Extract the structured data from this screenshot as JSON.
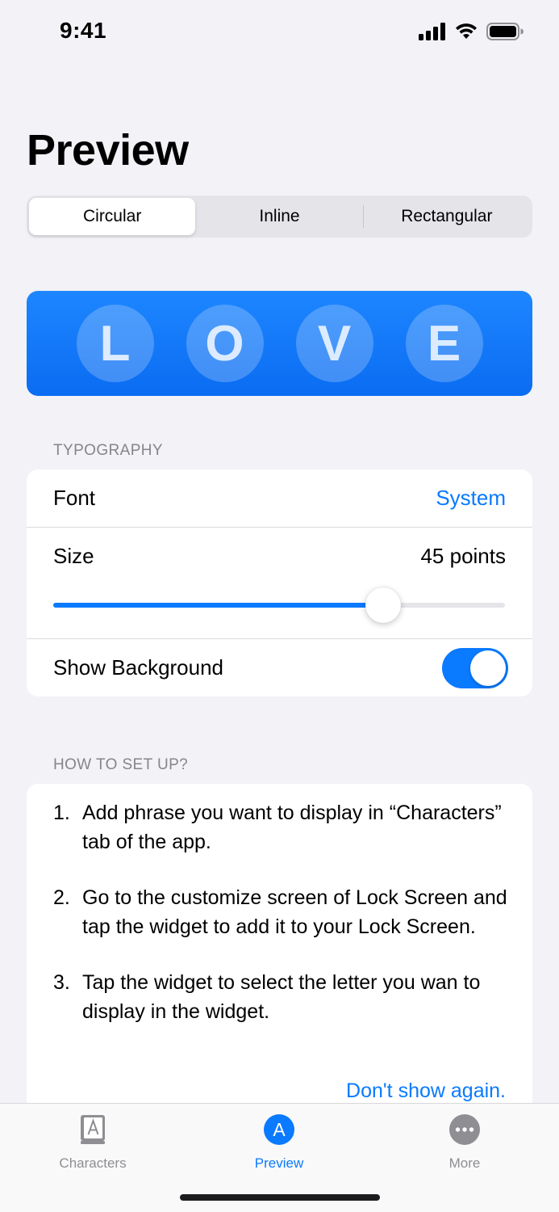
{
  "status_bar": {
    "time": "9:41"
  },
  "title": "Preview",
  "segments": [
    {
      "label": "Circular",
      "active": true
    },
    {
      "label": "Inline",
      "active": false
    },
    {
      "label": "Rectangular",
      "active": false
    }
  ],
  "preview": {
    "letters": [
      "L",
      "O",
      "V",
      "E"
    ],
    "background_color": "#0A6CF2"
  },
  "typography": {
    "header": "TYPOGRAPHY",
    "font_label": "Font",
    "font_value": "System",
    "size_label": "Size",
    "size_value": "45 points",
    "size_slider_fraction": 0.73,
    "show_background_label": "Show Background",
    "show_background_on": true
  },
  "setup": {
    "header": "HOW TO SET UP?",
    "steps": [
      {
        "num": "1.",
        "text": "Add phrase you want to display in “Characters” tab of the app."
      },
      {
        "num": "2.",
        "text": "Go to the customize screen of Lock Screen and tap the widget to add it to your Lock Screen."
      },
      {
        "num": "3.",
        "text": "Tap the widget to select the letter you wan to display in the widget."
      }
    ],
    "dont_show_label": "Don't show again."
  },
  "tab_bar": {
    "items": [
      {
        "label": "Characters",
        "icon": "book-letter-icon",
        "active": false
      },
      {
        "label": "Preview",
        "icon": "circle-a-icon",
        "active": true
      },
      {
        "label": "More",
        "icon": "ellipsis-circle-icon",
        "active": false
      }
    ]
  },
  "colors": {
    "accent": "#0A7AFF",
    "background": "#F2F2F7"
  }
}
